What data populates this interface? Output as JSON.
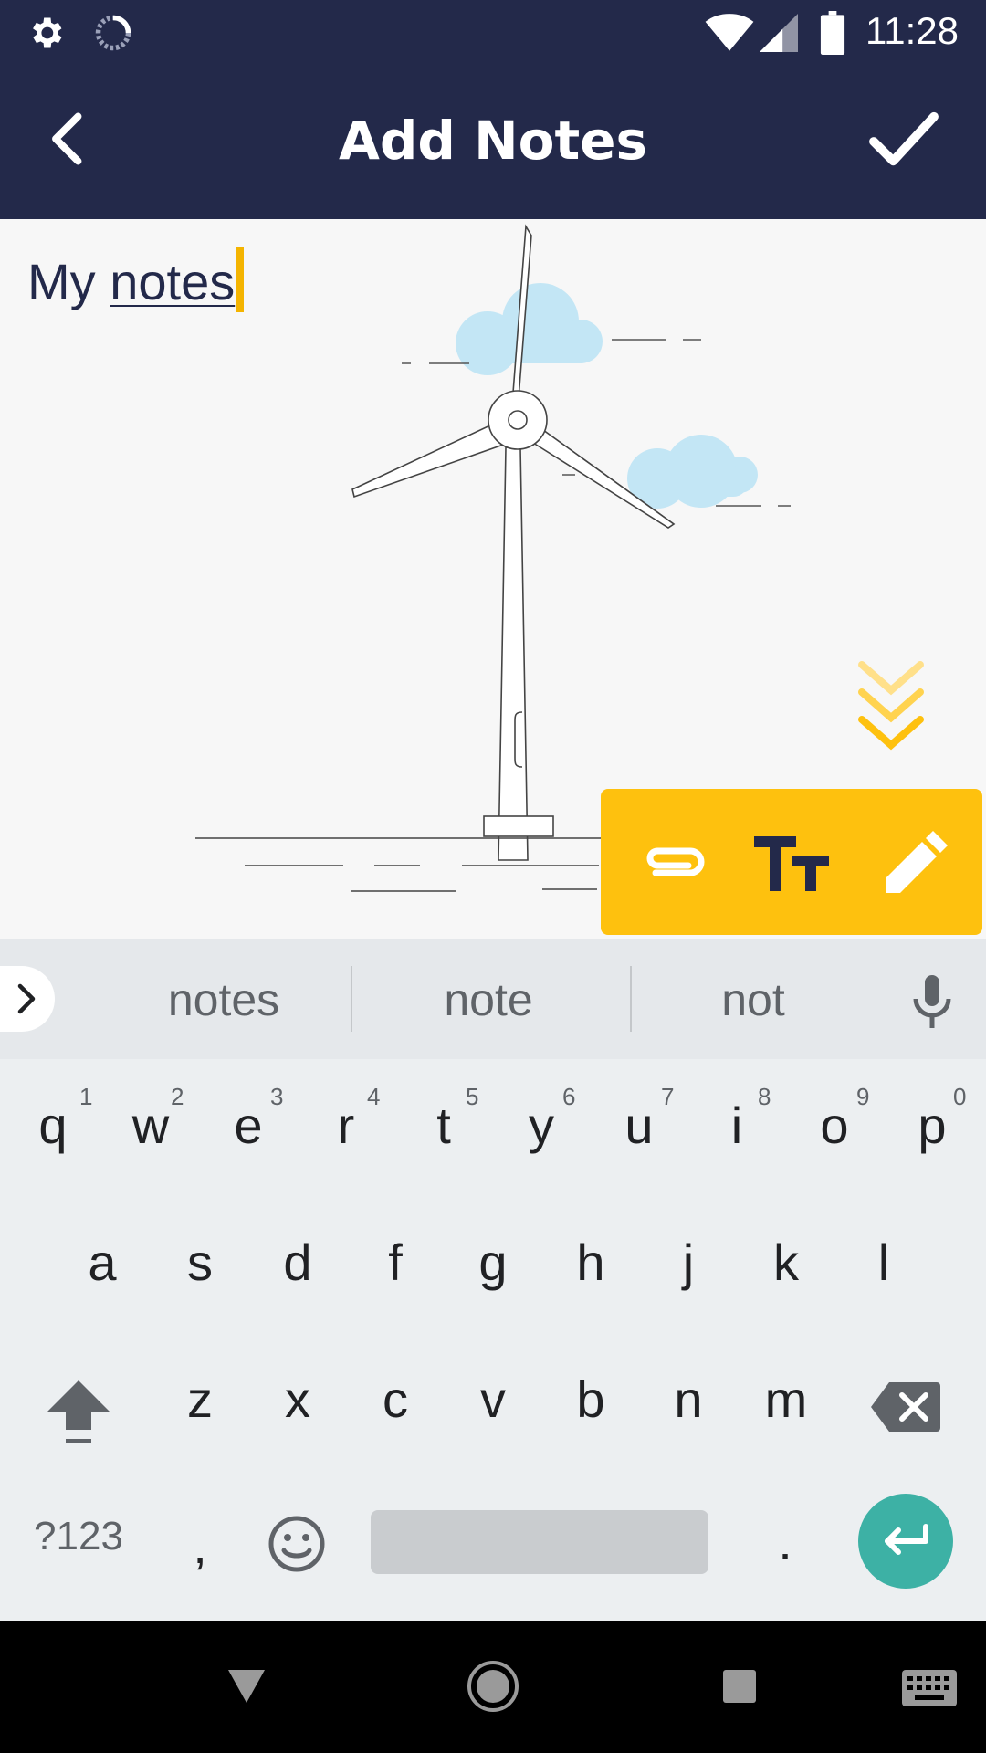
{
  "status_bar": {
    "time": "11:28"
  },
  "app_bar": {
    "title": "Add Notes"
  },
  "note": {
    "prefix": "My ",
    "word": "notes"
  },
  "toolbar": {
    "attach_label": "attach",
    "text_style_label": "Tт",
    "draw_label": "draw"
  },
  "suggestions": [
    "notes",
    "note",
    "not"
  ],
  "keyboard": {
    "row1": [
      "q",
      "w",
      "e",
      "r",
      "t",
      "y",
      "u",
      "i",
      "o",
      "p"
    ],
    "row1_hints": [
      "1",
      "2",
      "3",
      "4",
      "5",
      "6",
      "7",
      "8",
      "9",
      "0"
    ],
    "row2": [
      "a",
      "s",
      "d",
      "f",
      "g",
      "h",
      "j",
      "k",
      "l"
    ],
    "row3": [
      "z",
      "x",
      "c",
      "v",
      "b",
      "n",
      "m"
    ],
    "symbols_label": "?123",
    "comma_label": ",",
    "period_label": "."
  },
  "colors": {
    "header": "#23294a",
    "accent": "#fec10e",
    "enter": "#3db1a5"
  },
  "icons": [
    "gear-icon",
    "spinner-icon",
    "wifi-icon",
    "signal-icon",
    "battery-icon",
    "back-arrow-icon",
    "checkmark-icon",
    "double-chevron-down-icon",
    "paperclip-icon",
    "text-size-icon",
    "pencil-icon",
    "chevron-right-icon",
    "microphone-icon",
    "shift-icon",
    "backspace-icon",
    "emoji-icon",
    "enter-icon",
    "nav-back-icon",
    "nav-home-icon",
    "nav-recents-icon",
    "keyboard-icon"
  ]
}
